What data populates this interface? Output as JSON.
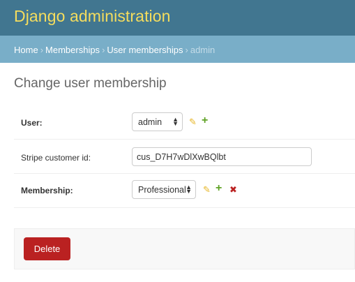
{
  "header": {
    "site_title": "Django administration"
  },
  "breadcrumbs": {
    "home": "Home",
    "memberships": "Memberships",
    "user_memberships": "User memberships",
    "current": "admin",
    "separator": "›"
  },
  "page": {
    "title": "Change user membership"
  },
  "form": {
    "user": {
      "label": "User:",
      "value": "admin"
    },
    "stripe_customer_id": {
      "label": "Stripe customer id:",
      "value": "cus_D7H7wDlXwBQlbt"
    },
    "membership": {
      "label": "Membership:",
      "value": "Professional"
    }
  },
  "actions": {
    "delete_label": "Delete"
  },
  "colors": {
    "header": "#417690",
    "title": "#f5dd5d",
    "breadcrumbs": "#79aec8",
    "delete": "#ba2121"
  },
  "icons": {
    "edit": "pencil-icon",
    "add": "plus-icon",
    "remove": "cross-icon",
    "dropdown": "chevron-updown-icon"
  }
}
